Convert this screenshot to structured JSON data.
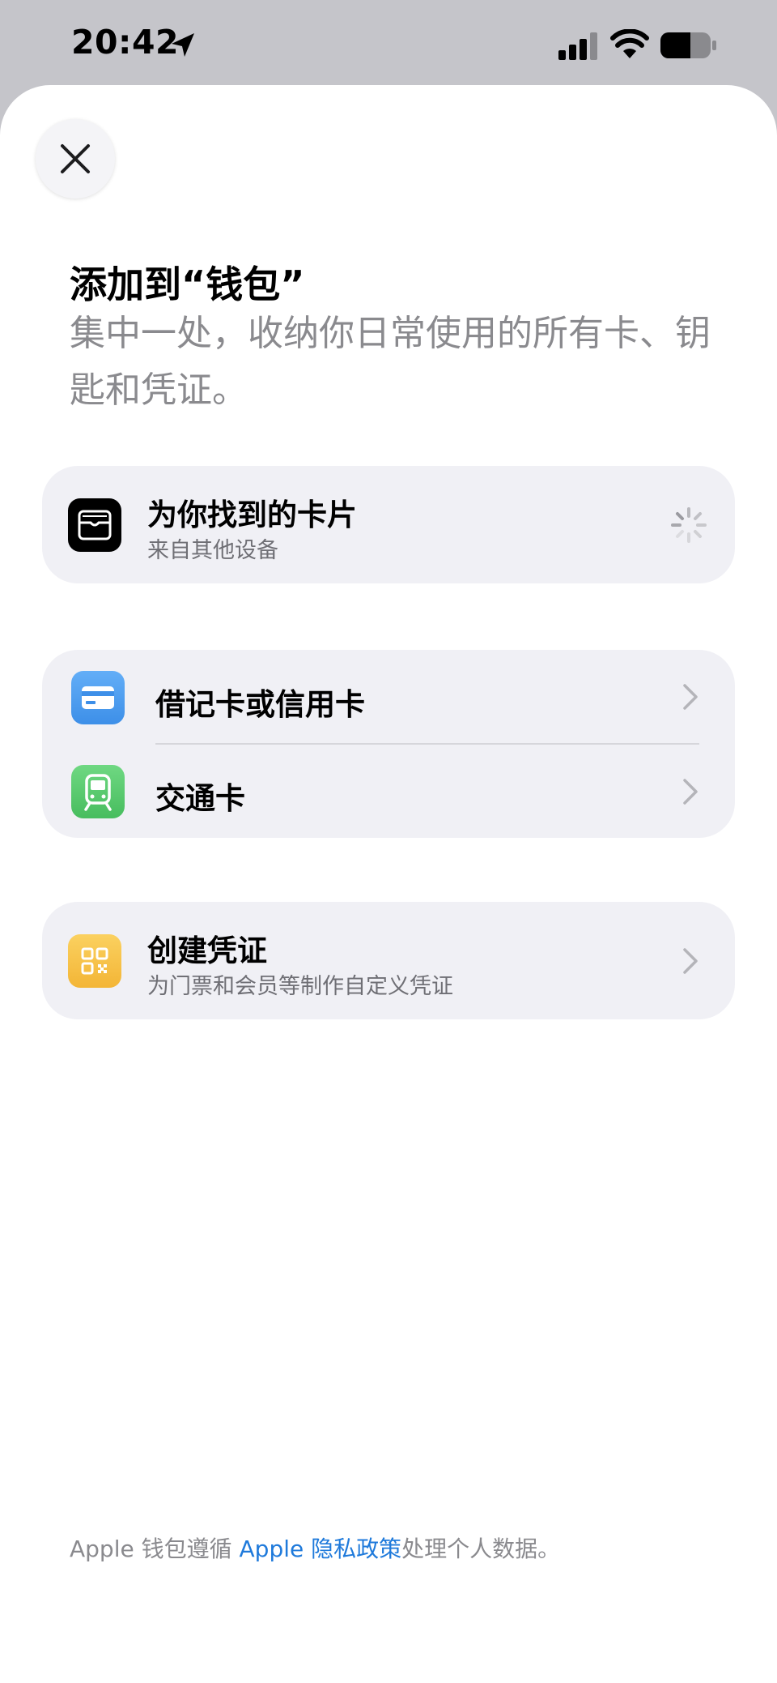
{
  "status_bar": {
    "time": "20:42"
  },
  "header": {
    "title": "添加到“钱包”",
    "subtitle": "集中一处，收纳你日常使用的所有卡、钥匙和凭证。"
  },
  "found_cards": {
    "title": "为你找到的卡片",
    "subtitle": "来自其他设备"
  },
  "card_types": [
    {
      "label": "借记卡或信用卡",
      "icon": "credit-card-icon"
    },
    {
      "label": "交通卡",
      "icon": "train-icon"
    }
  ],
  "create_pass": {
    "title": "创建凭证",
    "subtitle": "为门票和会员等制作自定义凭证"
  },
  "footer": {
    "prefix": "Apple 钱包遵循 ",
    "link": "Apple 隐私政策",
    "suffix": "处理个人数据。"
  },
  "colors": {
    "accent_blue": "#1f7adb",
    "card_icon_blue": "#4a9bf0",
    "transit_icon_green": "#55c96b",
    "pass_icon_yellow": "#f7c24a",
    "group_background": "#f0f0f5"
  }
}
